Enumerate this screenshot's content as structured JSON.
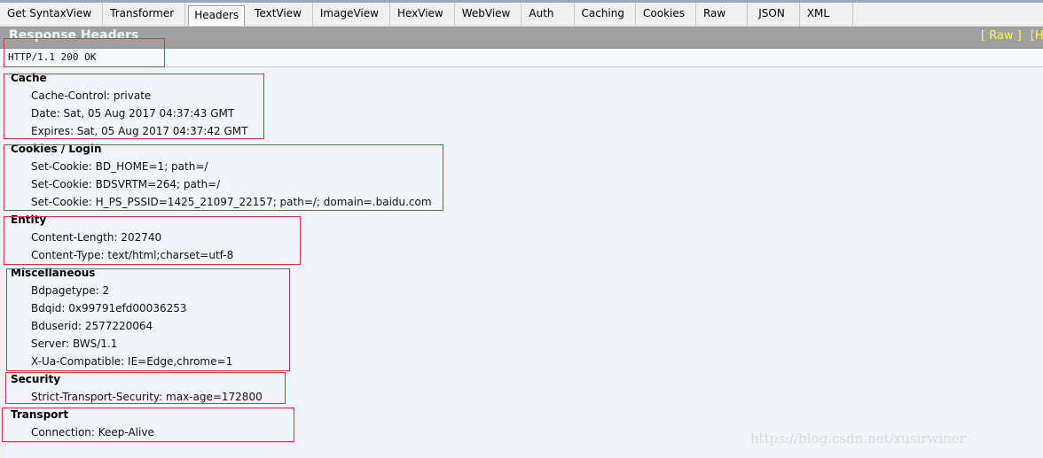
{
  "tabs": [
    {
      "label": "Get SyntaxView",
      "active": false
    },
    {
      "label": "Transformer",
      "active": false
    },
    {
      "label": "Headers",
      "active": true
    },
    {
      "label": "TextView",
      "active": false
    },
    {
      "label": "ImageView",
      "active": false
    },
    {
      "label": "HexView",
      "active": false
    },
    {
      "label": "WebView",
      "active": false
    },
    {
      "label": "Auth",
      "active": false
    },
    {
      "label": "Caching",
      "active": false
    },
    {
      "label": "Cookies",
      "active": false
    },
    {
      "label": "Raw",
      "active": false
    },
    {
      "label": "JSON",
      "active": false
    },
    {
      "label": "XML",
      "active": false
    }
  ],
  "header_bar": {
    "title": "Response Headers",
    "links": [
      "[ Raw ]",
      "[Header Definitions]"
    ]
  },
  "status_line": "HTTP/1.1 200 OK",
  "groups": [
    {
      "title": "Cache",
      "headers": [
        "Cache-Control: private",
        "Date: Sat, 05 Aug 2017 04:37:43 GMT",
        "Expires: Sat, 05 Aug 2017 04:37:42 GMT"
      ]
    },
    {
      "title": "Cookies / Login",
      "headers": [
        "Set-Cookie: BD_HOME=1; path=/",
        "Set-Cookie: BDSVRTM=264; path=/",
        "Set-Cookie: H_PS_PSSID=1425_21097_22157; path=/; domain=.baidu.com"
      ]
    },
    {
      "title": "Entity",
      "headers": [
        "Content-Length: 202740",
        "Content-Type: text/html;charset=utf-8"
      ]
    },
    {
      "title": "Miscellaneous",
      "headers": [
        "Bdpagetype: 2",
        "Bdqid: 0x99791efd00036253",
        "Bduserid: 2577220064",
        "Server: BWS/1.1",
        "X-Ua-Compatible: IE=Edge,chrome=1"
      ]
    },
    {
      "title": "Security",
      "headers": [
        "Strict-Transport-Security: max-age=172800"
      ]
    },
    {
      "title": "Transport",
      "headers": [
        "Connection: Keep-Alive"
      ]
    }
  ],
  "watermark": "https://blog.csdn.net/xusirwiner",
  "colors": {
    "header_link": "#ffff33",
    "annotation_box": "#e0303a",
    "header_bar": "#a0a0a0"
  }
}
